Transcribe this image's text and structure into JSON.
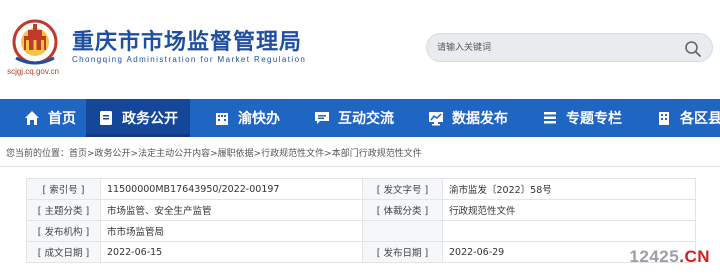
{
  "header": {
    "site_title": "重庆市市场监督管理局",
    "site_subtitle": "Chongqing Administration for Market Regulation",
    "domain": "scjgj.cq.gov.cn"
  },
  "search": {
    "placeholder": "请输入关键词"
  },
  "nav": {
    "items": [
      {
        "label": "首页",
        "icon": "home-icon"
      },
      {
        "label": "政务公开",
        "icon": "document-icon",
        "active": true
      },
      {
        "label": "渝快办",
        "icon": "building-icon"
      },
      {
        "label": "互动交流",
        "icon": "chat-icon"
      },
      {
        "label": "数据发布",
        "icon": "monitor-chart-icon"
      },
      {
        "label": "专题专栏",
        "icon": "list-icon"
      },
      {
        "label": "各区县局",
        "icon": "building-icon"
      }
    ]
  },
  "breadcrumb": {
    "prefix": "您当前的位置：",
    "path": "首页>政务公开>法定主动公开内容>履职依据>行政规范性文件>本部门行政规范性文件"
  },
  "info": {
    "rows": [
      {
        "l1": "[ 索引号 ]",
        "v1": "11500000MB17643950/2022-00197",
        "l2": "[ 发文字号 ]",
        "v2": "渝市监发〔2022〕58号"
      },
      {
        "l1": "[ 主题分类 ]",
        "v1": "市场监管、安全生产监管",
        "l2": "[ 体裁分类 ]",
        "v2": "行政规范性文件"
      },
      {
        "l1": "[ 发布机构 ]",
        "v1": "市市场监管局",
        "l2": "",
        "v2": ""
      },
      {
        "l1": "[ 成文日期 ]",
        "v1": "2022-06-15",
        "l2": "[ 发布日期 ]",
        "v2": "2022-06-29"
      }
    ]
  },
  "watermark": {
    "number": "12425",
    "dot": ".",
    "suffix": "CN"
  },
  "colors": {
    "nav_bg": "#1f65c2",
    "nav_active": "#14479a",
    "title_blue": "#1f4fa0",
    "logo_red": "#c0392b"
  }
}
